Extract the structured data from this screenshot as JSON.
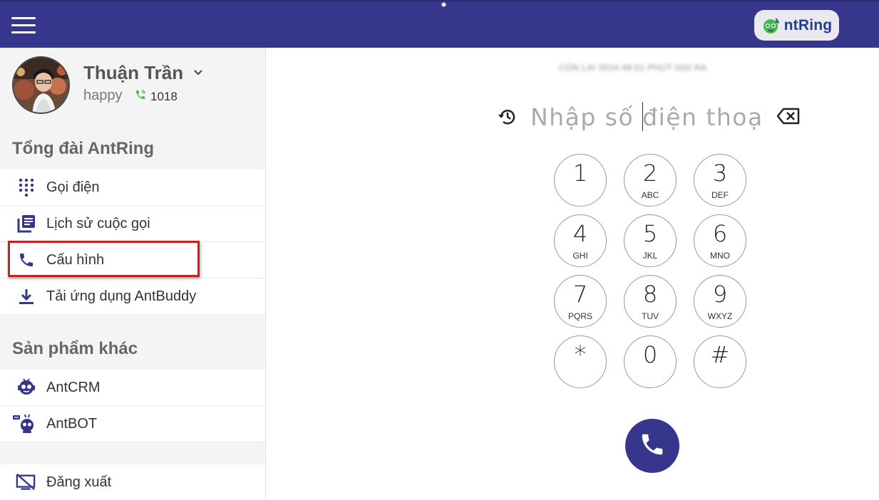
{
  "header": {
    "menu_icon": "hamburger-icon",
    "brand": {
      "prefix": "A",
      "text": "ntRing",
      "logo_icon": "ant-robot-icon"
    },
    "colors": {
      "bar": "#36368c",
      "brand_text": "#1f3f8f"
    }
  },
  "profile": {
    "name": "Thuận Trần",
    "status": "happy",
    "extension": "1018",
    "dropdown_icon": "chevron-down-icon",
    "ext_icon": "phone-icon"
  },
  "sidebar": {
    "section1_title": "Tổng đài AntRing",
    "section1_items": [
      {
        "label": "Gọi điện",
        "icon": "dialpad-icon"
      },
      {
        "label": "Lịch sử cuộc gọi",
        "icon": "call-history-icon"
      },
      {
        "label": "Cấu hình",
        "icon": "phone-icon"
      },
      {
        "label": "Tải ứng dụng AntBuddy",
        "icon": "download-icon"
      }
    ],
    "section2_title": "Sản phẩm khác",
    "section2_items": [
      {
        "label": "AntCRM",
        "icon": "antcrm-robot-icon"
      },
      {
        "label": "AntBOT",
        "icon": "antbot-robot-icon"
      }
    ],
    "logout_label": "Đăng xuất",
    "logout_icon": "logout-icon",
    "highlight_color": "#cc2020"
  },
  "dialer": {
    "blurred_notice": "CÒN LẠI 3024:49:51 PHÚT GỌI RA",
    "input_placeholder": "Nhập số điện thoại",
    "input_value": "",
    "keys": [
      {
        "digit": "1",
        "letters": ""
      },
      {
        "digit": "2",
        "letters": "ABC"
      },
      {
        "digit": "3",
        "letters": "DEF"
      },
      {
        "digit": "4",
        "letters": "GHI"
      },
      {
        "digit": "5",
        "letters": "JKL"
      },
      {
        "digit": "6",
        "letters": "MNO"
      },
      {
        "digit": "7",
        "letters": "PQRS"
      },
      {
        "digit": "8",
        "letters": "TUV"
      },
      {
        "digit": "9",
        "letters": "WXYZ"
      },
      {
        "digit": "*",
        "letters": ""
      },
      {
        "digit": "0",
        "letters": ""
      },
      {
        "digit": "#",
        "letters": ""
      }
    ],
    "call_button_icon": "phone-icon",
    "history_icon": "history-icon",
    "backspace_icon": "backspace-icon",
    "call_button_color": "#36368c"
  }
}
